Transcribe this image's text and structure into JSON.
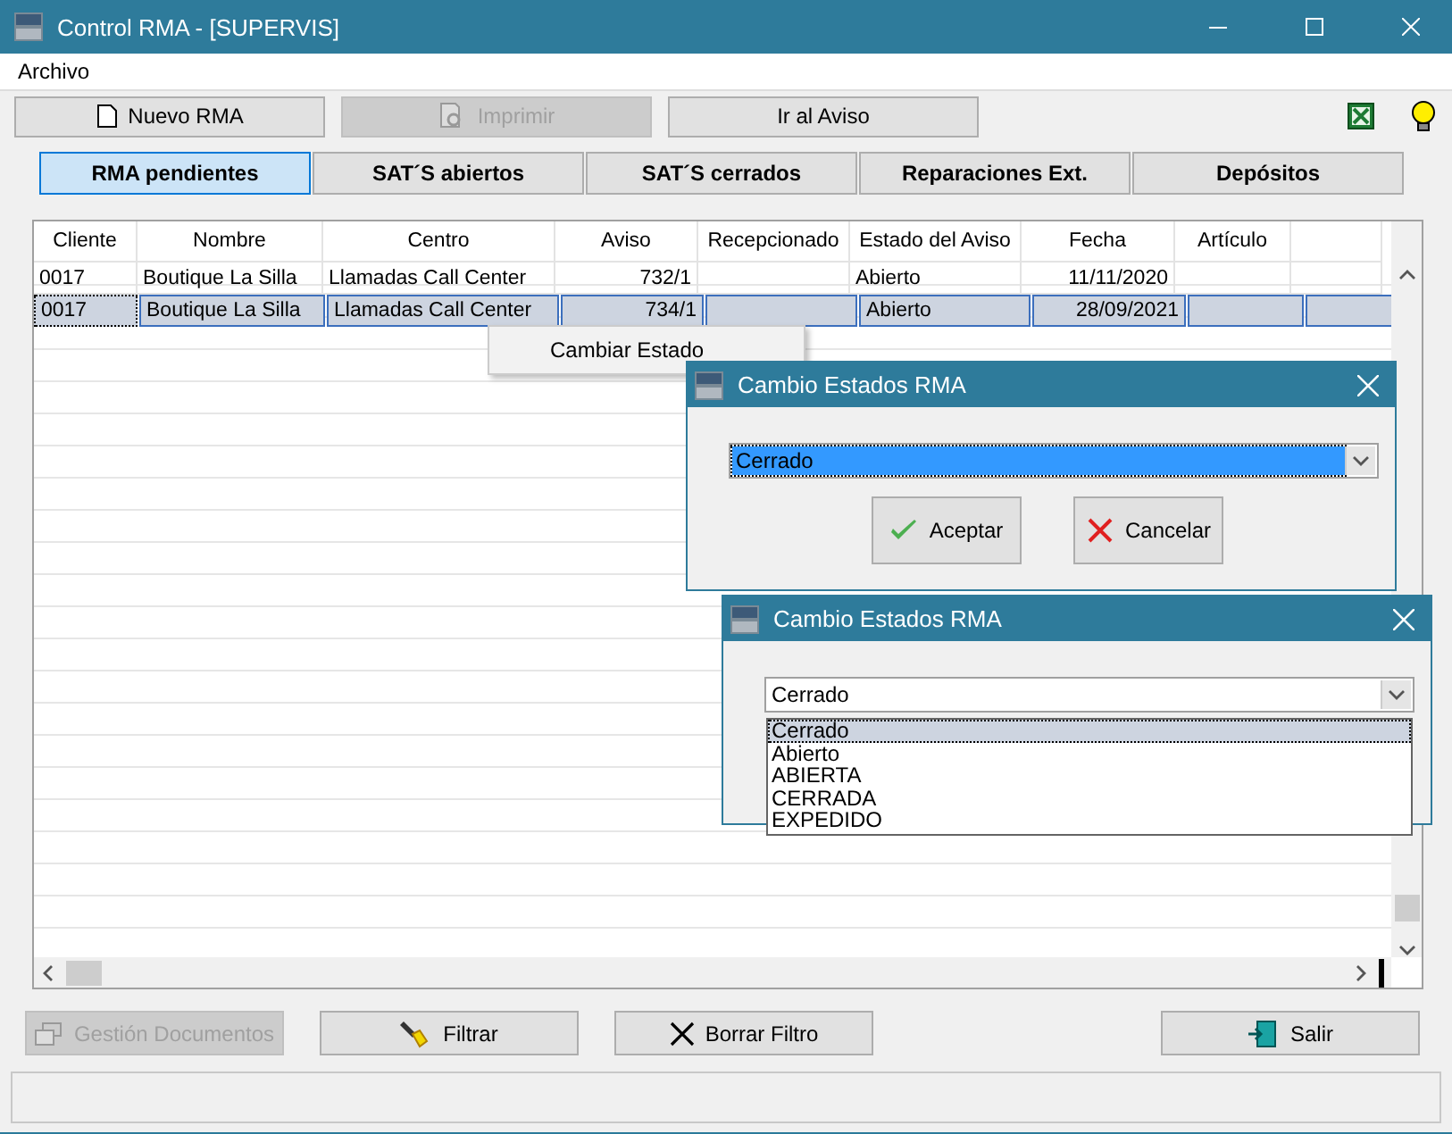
{
  "window": {
    "title": "Control RMA - [SUPERVIS]"
  },
  "menu": [
    "Archivo"
  ],
  "toolbar": [
    {
      "label": "Nuevo RMA",
      "disabled": false
    },
    {
      "label": "Imprimir",
      "disabled": true
    },
    {
      "label": "Ir al Aviso",
      "disabled": false
    }
  ],
  "tabs": [
    {
      "label": "RMA pendientes",
      "selected": true
    },
    {
      "label": "SAT´S abiertos",
      "selected": false
    },
    {
      "label": "SAT´S cerrados",
      "selected": false
    },
    {
      "label": "Reparaciones Ext.",
      "selected": false
    },
    {
      "label": "Depósitos",
      "selected": false
    }
  ],
  "table": {
    "columns": [
      {
        "label": "Cliente"
      },
      {
        "label": "Nombre"
      },
      {
        "label": "Centro"
      },
      {
        "label": "Aviso"
      },
      {
        "label": "Recepcionado"
      },
      {
        "label": "Estado del Aviso"
      },
      {
        "label": "Fecha"
      },
      {
        "label": "Artículo"
      }
    ],
    "rows": [
      {
        "selected": false,
        "cells": [
          "0017",
          "Boutique La Silla",
          "Llamadas Call Center",
          "732/1",
          "",
          "Abierto",
          "11/11/2020",
          ""
        ]
      },
      {
        "selected": true,
        "cells": [
          "0017",
          "Boutique La Silla",
          "Llamadas Call Center",
          "734/1",
          "",
          "Abierto",
          "28/09/2021",
          ""
        ]
      }
    ]
  },
  "context_menu": {
    "items": [
      "Cambiar Estado"
    ]
  },
  "dialogs": [
    {
      "title": "Cambio Estados RMA",
      "select": {
        "value": "Cerrado",
        "focused": true
      },
      "buttons": [
        {
          "label": "Aceptar"
        },
        {
          "label": "Cancelar"
        }
      ]
    },
    {
      "title": "Cambio Estados RMA",
      "select": {
        "value": "Cerrado",
        "focused": false
      },
      "options": [
        {
          "label": "Cerrado",
          "selected": true
        },
        {
          "label": "Abierto",
          "selected": false
        },
        {
          "label": "ABIERTA",
          "selected": false
        },
        {
          "label": "CERRADA",
          "selected": false
        },
        {
          "label": "EXPEDIDO",
          "selected": false
        }
      ]
    }
  ],
  "bottom_buttons": [
    {
      "label": "Gestión Documentos",
      "disabled": true
    },
    {
      "label": "Filtrar",
      "disabled": false
    },
    {
      "label": "Borrar Filtro",
      "disabled": false
    },
    {
      "label": "Salir",
      "disabled": false
    }
  ]
}
